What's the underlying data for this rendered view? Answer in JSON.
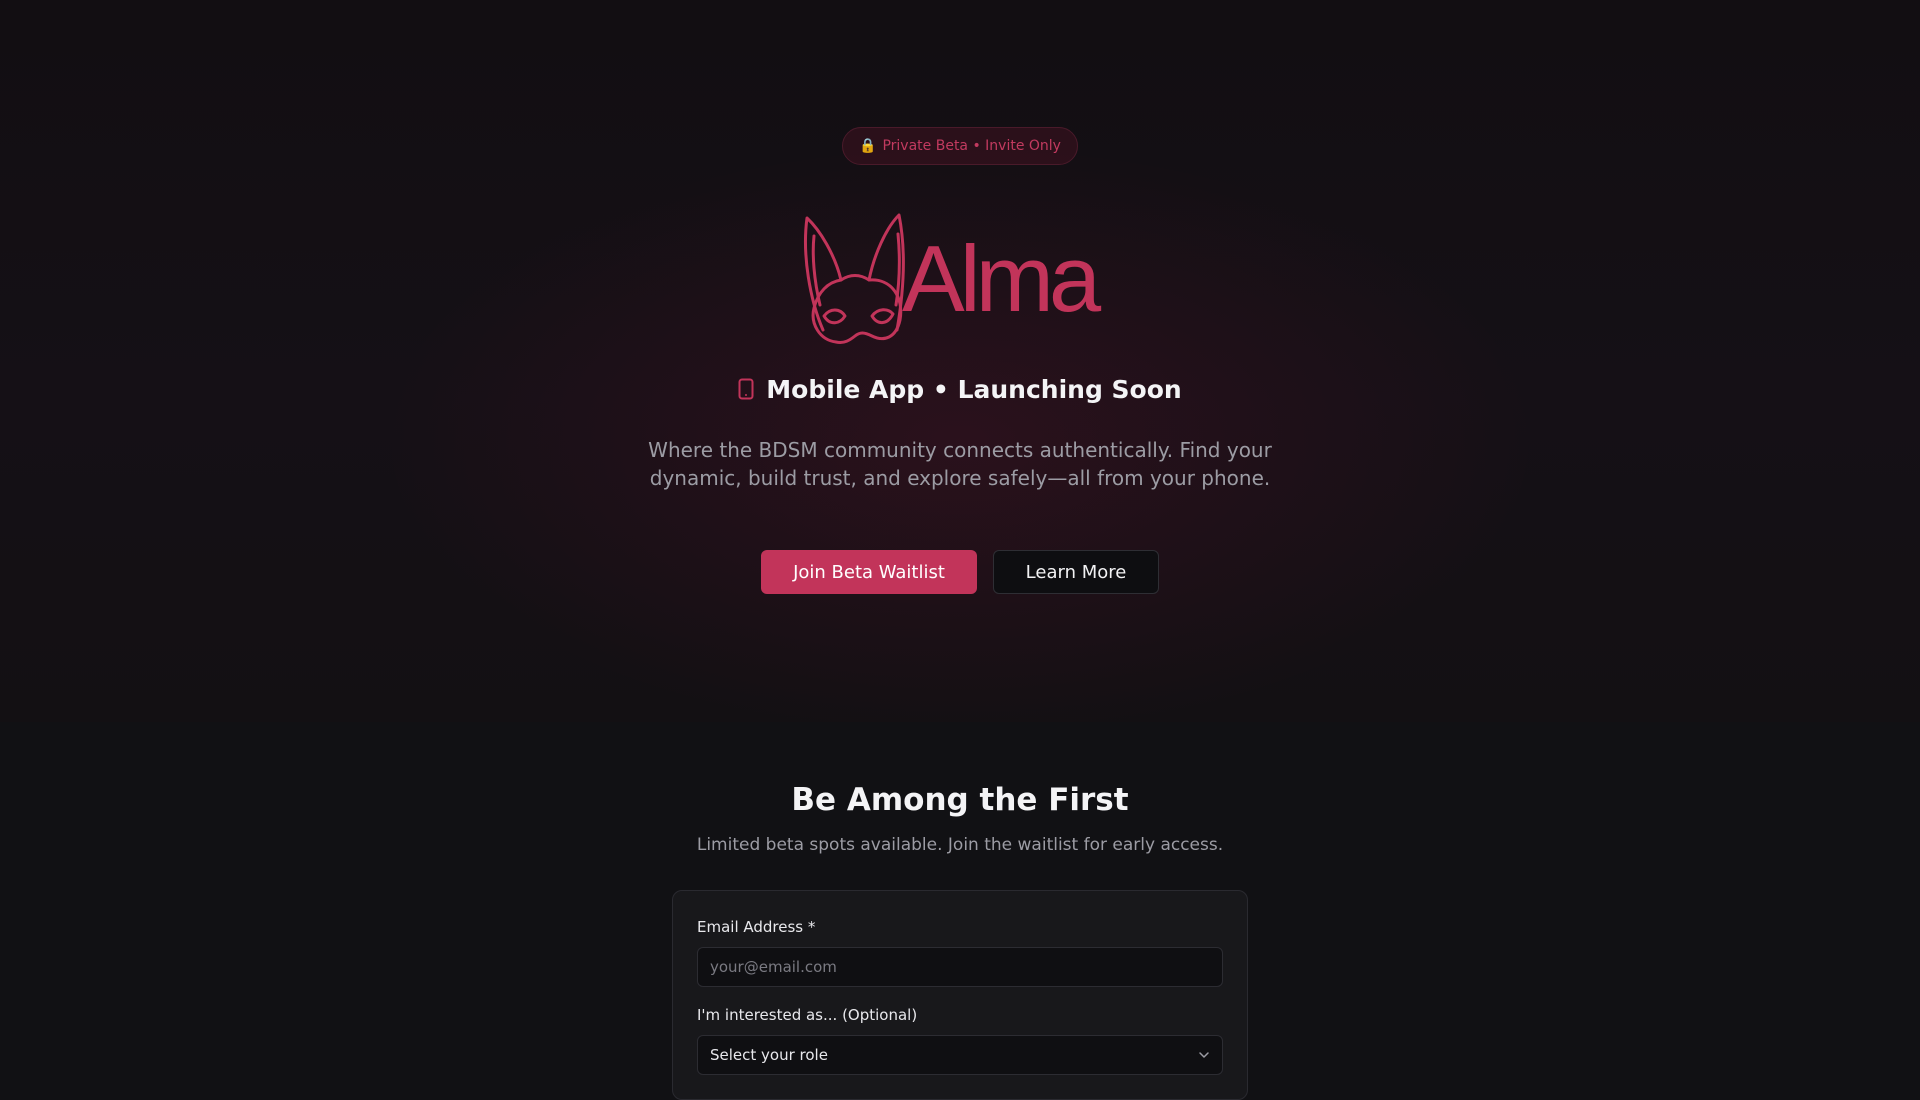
{
  "hero": {
    "badge_icon": "lock-icon",
    "badge_text": "Private Beta • Invite Only",
    "logo_text": "Alma",
    "tagline": "Mobile App • Launching Soon",
    "description": "Where the BDSM community connects authentically. Find your dynamic, build trust, and explore safely—all from your phone.",
    "primary_button": "Join Beta Waitlist",
    "secondary_button": "Learn More"
  },
  "waitlist": {
    "title": "Be Among the First",
    "subtitle": "Limited beta spots available. Join the waitlist for early access.",
    "email_label": "Email Address *",
    "email_placeholder": "your@email.com",
    "role_label": "I'm interested as... (Optional)",
    "role_selected": "Select your role"
  },
  "colors": {
    "accent": "#c2345a",
    "background": "#111114",
    "card": "#18181b"
  }
}
